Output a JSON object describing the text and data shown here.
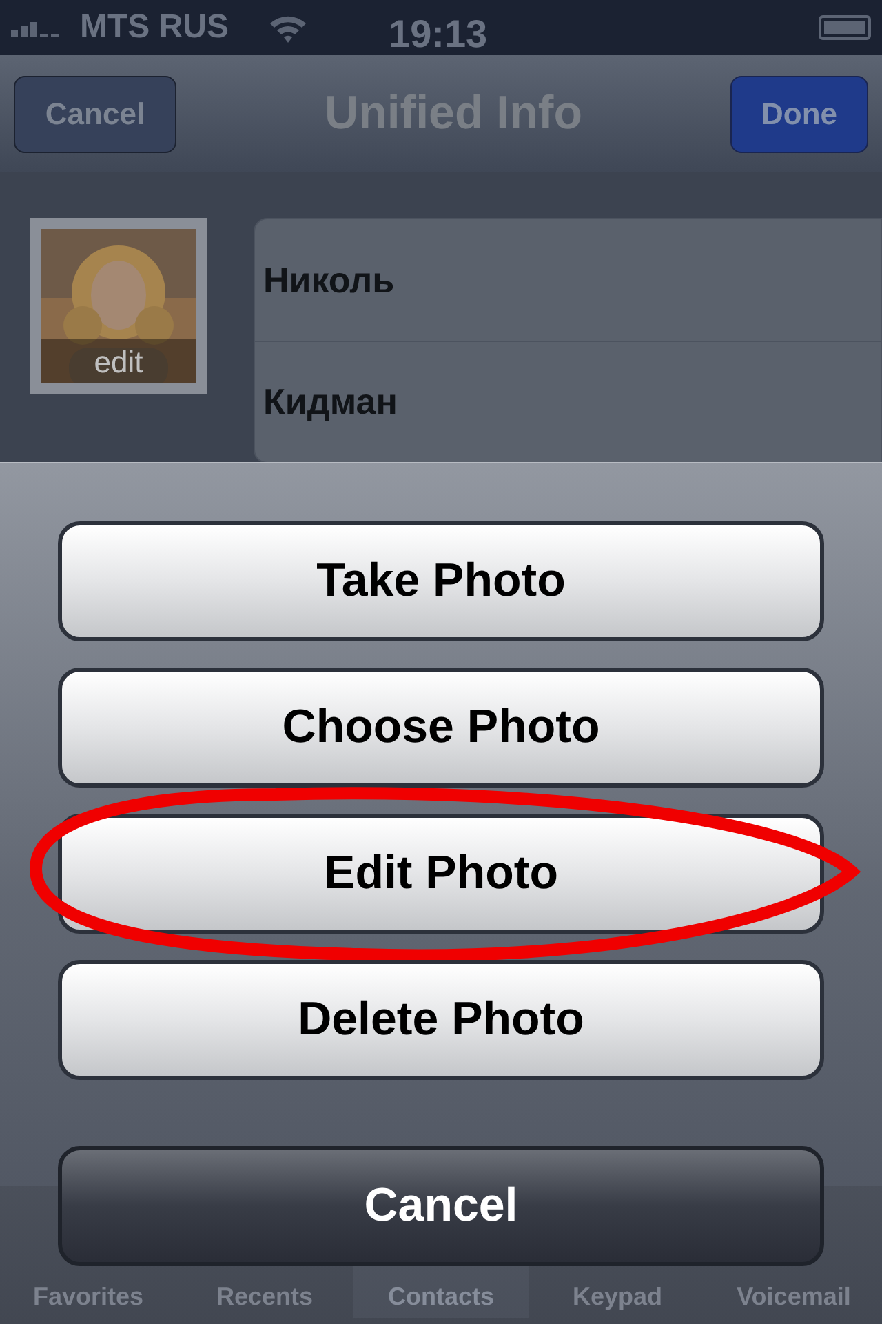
{
  "status_bar": {
    "carrier": "MTS RUS",
    "time": "19:13"
  },
  "nav_bar": {
    "title": "Unified Info",
    "left_button": "Cancel",
    "right_button": "Done"
  },
  "contact": {
    "photo": {
      "kind": "picture",
      "edit_label": "edit"
    },
    "fields": [
      "Николь",
      "Кидман"
    ]
  },
  "action_sheet": {
    "buttons": [
      {
        "label": "Take Photo",
        "kind": "default",
        "highlighted": false
      },
      {
        "label": "Choose Photo",
        "kind": "default",
        "highlighted": false
      },
      {
        "label": "Edit Photo",
        "kind": "default",
        "highlighted": true
      },
      {
        "label": "Delete Photo",
        "kind": "default",
        "highlighted": false
      },
      {
        "label": "Cancel",
        "kind": "cancel",
        "highlighted": false
      }
    ]
  },
  "tab_bar": [
    {
      "label": "Favorites",
      "selected": false
    },
    {
      "label": "Recents",
      "selected": false
    },
    {
      "label": "Contacts",
      "selected": true
    },
    {
      "label": "Keypad",
      "selected": false
    },
    {
      "label": "Voicemail",
      "selected": false
    }
  ]
}
